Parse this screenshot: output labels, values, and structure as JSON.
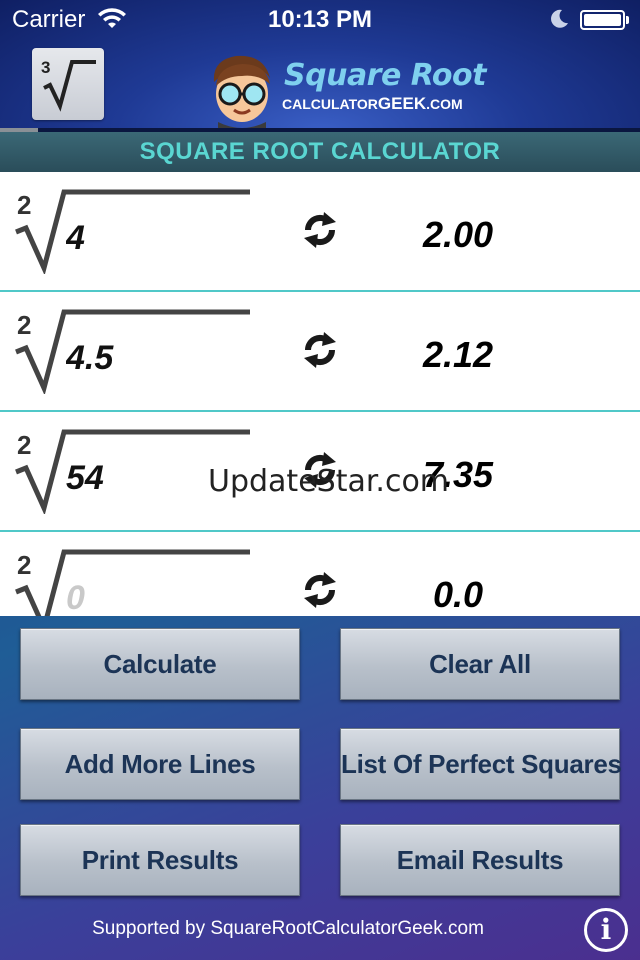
{
  "status_bar": {
    "carrier": "Carrier",
    "time": "10:13 PM",
    "battery_percent": 100
  },
  "header": {
    "cube_root_button": {
      "index": "3",
      "icon": "cube-root-icon"
    },
    "logo": {
      "title": "Square Root",
      "subtitle_prefix": "CALCULATOR",
      "subtitle_geek": "GEEK",
      "subtitle_suffix": ".COM"
    },
    "progress_fraction": 0.06
  },
  "section_title": "SQUARE ROOT CALCULATOR",
  "rows": [
    {
      "index": "2",
      "value": "4",
      "placeholder": "",
      "result": "2.00"
    },
    {
      "index": "2",
      "value": "4.5",
      "placeholder": "",
      "result": "2.12"
    },
    {
      "index": "2",
      "value": "54",
      "placeholder": "",
      "result": "7.35"
    },
    {
      "index": "2",
      "value": "",
      "placeholder": "0",
      "result": "0.0"
    }
  ],
  "watermark": "UpdateStar.com",
  "buttons": {
    "calculate": "Calculate",
    "clear_all": "Clear All",
    "add_more_lines": "Add More Lines",
    "list_perfect_squares": "List Of Perfect Squares",
    "print_results": "Print Results",
    "email_results": "Email Results"
  },
  "footer": {
    "text": "Supported by SquareRootCalculatorGeek.com",
    "info_label": "i"
  },
  "colors": {
    "accent_teal": "#5ad6d2",
    "row_divider": "#50c8c8",
    "button_text": "#1c3456"
  }
}
